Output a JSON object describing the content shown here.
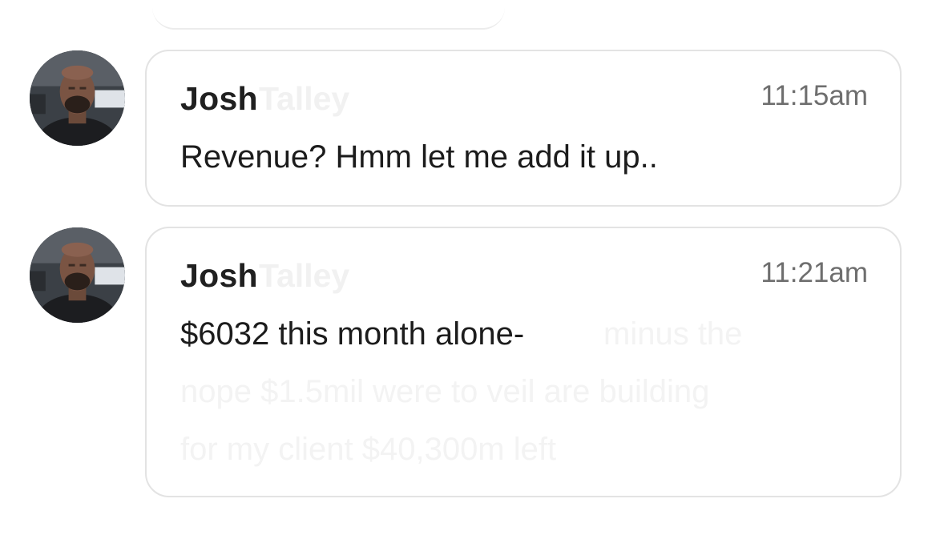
{
  "messages": [
    {
      "sender": "Josh",
      "sender_faded": "Talley",
      "time": "11:15am",
      "text": "Revenue? Hmm let me add it up.."
    },
    {
      "sender": "Josh",
      "sender_faded": "Talley",
      "time": "11:21am",
      "text": "$6032 this month alone-",
      "faded_lines": [
        "minus the",
        "nope $1.5mil were to veil are building",
        "for my client $40,300m left"
      ]
    }
  ],
  "colors": {
    "bubble_border": "#e3e3e3",
    "time_text": "#6e6e6e",
    "primary_text": "#1c1c1c"
  }
}
